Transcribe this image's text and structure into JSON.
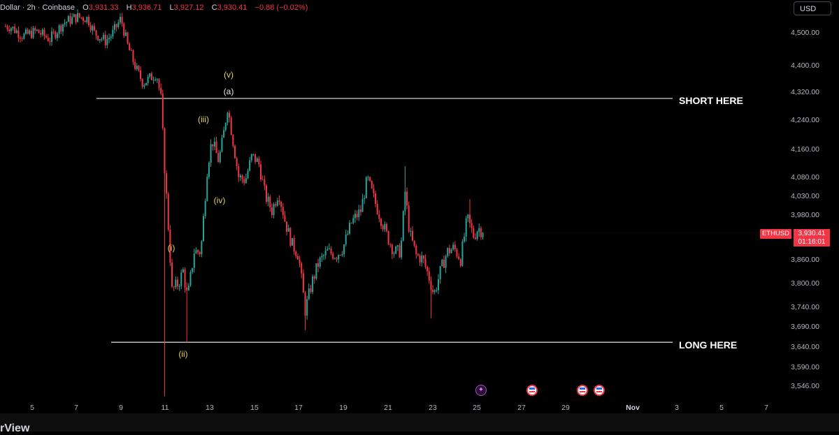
{
  "header": {
    "title": "Dollar · 2h · Coinbase",
    "ohlc": [
      {
        "key": "O",
        "value": "3,931.33"
      },
      {
        "key": "H",
        "value": "3,936.71"
      },
      {
        "key": "L",
        "value": "3,927.12"
      },
      {
        "key": "C",
        "value": "3,930.41"
      }
    ],
    "change": "−0.88 (−0.02%)"
  },
  "currency_button": "USD",
  "symbol_tag": "ETHUSD",
  "last_price": "3,930.41",
  "countdown": "01:16:01",
  "brand": "rView",
  "colors": {
    "up": "#26a69a",
    "down": "#f23645",
    "level_line": "#cfcfcf",
    "wave_yellow": "#e8d36a"
  },
  "annotations": {
    "short_label": "SHORT HERE",
    "long_label": "LONG HERE",
    "waves": [
      "(v)",
      "(a)",
      "(iii)",
      "(iv)",
      "(i)",
      "(ii)"
    ]
  },
  "chart_data": {
    "type": "candlestick",
    "symbol": "ETHUSD",
    "timeframe": "2h",
    "exchange": "Coinbase",
    "y_ticks": [
      "4,500.00",
      "4,400.00",
      "4,320.00",
      "4,240.00",
      "4,160.00",
      "4,080.00",
      "4,030.00",
      "3,980.00",
      "3,860.00",
      "3,800.00",
      "3,740.00",
      "3,690.00",
      "3,640.00",
      "3,590.00",
      "3,546.00"
    ],
    "x_ticks": [
      "5",
      "7",
      "9",
      "11",
      "13",
      "15",
      "17",
      "19",
      "21",
      "23",
      "25",
      "27",
      "29",
      "Nov",
      "3",
      "5",
      "7"
    ],
    "x_range": [
      "Oct 4",
      "Nov 7"
    ],
    "y_range": [
      3520,
      4560
    ],
    "levels": [
      {
        "label": "SHORT HERE",
        "price": 4300
      },
      {
        "label": "LONG HERE",
        "price": 3650
      }
    ],
    "close_path": [
      {
        "day": 4.0,
        "price": 4520
      },
      {
        "day": 4.6,
        "price": 4490
      },
      {
        "day": 5.2,
        "price": 4505
      },
      {
        "day": 5.8,
        "price": 4480
      },
      {
        "day": 6.4,
        "price": 4530
      },
      {
        "day": 7.0,
        "price": 4550
      },
      {
        "day": 7.5,
        "price": 4545
      },
      {
        "day": 7.8,
        "price": 4500
      },
      {
        "day": 8.3,
        "price": 4475
      },
      {
        "day": 8.6,
        "price": 4495
      },
      {
        "day": 9.0,
        "price": 4545
      },
      {
        "day": 9.3,
        "price": 4460
      },
      {
        "day": 9.7,
        "price": 4385
      },
      {
        "day": 10.0,
        "price": 4345
      },
      {
        "day": 10.3,
        "price": 4360
      },
      {
        "day": 10.6,
        "price": 4375
      },
      {
        "day": 10.8,
        "price": 4300
      },
      {
        "day": 10.95,
        "price": 4120
      },
      {
        "day": 11.1,
        "price": 3980
      },
      {
        "day": 11.3,
        "price": 3780
      },
      {
        "day": 11.6,
        "price": 3800
      },
      {
        "day": 11.8,
        "price": 3830
      },
      {
        "day": 12.0,
        "price": 3760
      },
      {
        "day": 12.3,
        "price": 3880
      },
      {
        "day": 12.6,
        "price": 3880
      },
      {
        "day": 12.9,
        "price": 4110
      },
      {
        "day": 13.1,
        "price": 4185
      },
      {
        "day": 13.4,
        "price": 4125
      },
      {
        "day": 13.6,
        "price": 4190
      },
      {
        "day": 13.8,
        "price": 4275
      },
      {
        "day": 14.0,
        "price": 4200
      },
      {
        "day": 14.3,
        "price": 4080
      },
      {
        "day": 14.6,
        "price": 4070
      },
      {
        "day": 14.9,
        "price": 4140
      },
      {
        "day": 15.2,
        "price": 4120
      },
      {
        "day": 15.5,
        "price": 4030
      },
      {
        "day": 15.8,
        "price": 3990
      },
      {
        "day": 16.1,
        "price": 4040
      },
      {
        "day": 16.4,
        "price": 3960
      },
      {
        "day": 16.7,
        "price": 3900
      },
      {
        "day": 17.0,
        "price": 3870
      },
      {
        "day": 17.3,
        "price": 3730
      },
      {
        "day": 17.6,
        "price": 3800
      },
      {
        "day": 17.9,
        "price": 3850
      },
      {
        "day": 18.3,
        "price": 3880
      },
      {
        "day": 18.7,
        "price": 3870
      },
      {
        "day": 19.0,
        "price": 3890
      },
      {
        "day": 19.4,
        "price": 3960
      },
      {
        "day": 19.8,
        "price": 3990
      },
      {
        "day": 20.1,
        "price": 4075
      },
      {
        "day": 20.4,
        "price": 4020
      },
      {
        "day": 20.7,
        "price": 3970
      },
      {
        "day": 21.0,
        "price": 3920
      },
      {
        "day": 21.3,
        "price": 3880
      },
      {
        "day": 21.6,
        "price": 3880
      },
      {
        "day": 21.8,
        "price": 4040
      },
      {
        "day": 22.0,
        "price": 3930
      },
      {
        "day": 22.3,
        "price": 3870
      },
      {
        "day": 22.6,
        "price": 3860
      },
      {
        "day": 22.9,
        "price": 3810
      },
      {
        "day": 23.1,
        "price": 3770
      },
      {
        "day": 23.4,
        "price": 3830
      },
      {
        "day": 23.7,
        "price": 3880
      },
      {
        "day": 24.0,
        "price": 3890
      },
      {
        "day": 24.3,
        "price": 3860
      },
      {
        "day": 24.6,
        "price": 3970
      },
      {
        "day": 24.9,
        "price": 3920
      },
      {
        "day": 25.1,
        "price": 3945
      },
      {
        "day": 25.3,
        "price": 3930.41
      }
    ],
    "grid": false
  }
}
